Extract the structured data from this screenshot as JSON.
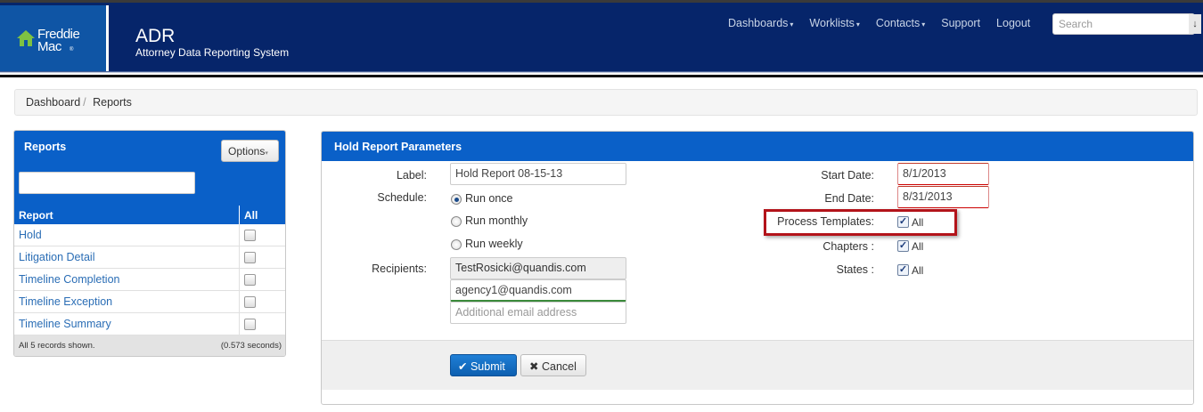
{
  "header": {
    "logo_line1": "Freddie",
    "logo_line2": "Mac",
    "logo_mark": "®",
    "app_title": "ADR",
    "app_subtitle": "Attorney Data Reporting System",
    "nav": [
      {
        "label": "Dashboards",
        "caret": "▾"
      },
      {
        "label": "Worklists",
        "caret": "▾"
      },
      {
        "label": "Contacts",
        "caret": "▾"
      },
      {
        "label": "Support",
        "caret": ""
      },
      {
        "label": "Logout",
        "caret": ""
      }
    ],
    "search_placeholder": "Search",
    "search_icon": "arrow-down-icon"
  },
  "breadcrumb": {
    "items": [
      "Dashboard",
      "Reports"
    ],
    "separator": "/"
  },
  "reports_panel": {
    "title": "Reports",
    "options_label": "Options",
    "filter_value": "",
    "col_report": "Report",
    "col_all": "All",
    "rows": [
      "Hold",
      "Litigation Detail",
      "Timeline Completion",
      "Timeline Exception",
      "Timeline Summary"
    ],
    "footer_left": "All 5 records shown.",
    "footer_right": "(0.573 seconds)"
  },
  "params_panel": {
    "title": "Hold Report Parameters",
    "label_label": "Label:",
    "label_value": "Hold Report 08-15-13",
    "schedule_label": "Schedule:",
    "schedule_options": [
      "Run once",
      "Run monthly",
      "Run weekly"
    ],
    "schedule_selected": "Run once",
    "recipients_label": "Recipients:",
    "recipients": [
      "TestRosicki@quandis.com",
      "agency1@quandis.com"
    ],
    "recipient_placeholder": "Additional email address",
    "start_label": "Start Date:",
    "start_value": "8/1/2013",
    "end_label": "End Date:",
    "end_value": "8/31/2013",
    "process_label": "Process Templates:",
    "chapters_label": "Chapters :",
    "states_label": "States :",
    "all_text": "All",
    "check_mark": "✓",
    "submit_label": "Submit",
    "submit_icon": "✔",
    "cancel_label": "Cancel",
    "cancel_icon": "✖"
  }
}
